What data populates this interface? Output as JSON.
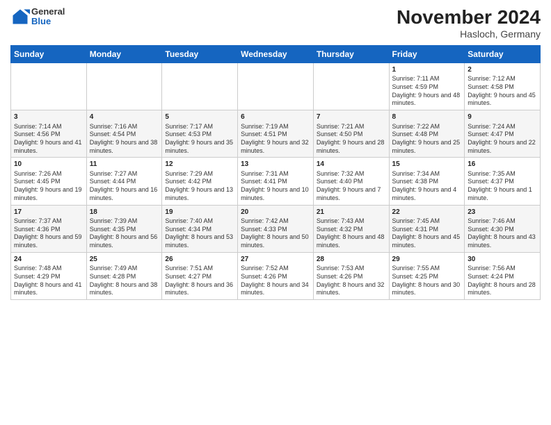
{
  "logo": {
    "general": "General",
    "blue": "Blue"
  },
  "title": "November 2024",
  "location": "Hasloch, Germany",
  "days_of_week": [
    "Sunday",
    "Monday",
    "Tuesday",
    "Wednesday",
    "Thursday",
    "Friday",
    "Saturday"
  ],
  "weeks": [
    [
      {
        "day": "",
        "sunrise": "",
        "sunset": "",
        "daylight": ""
      },
      {
        "day": "",
        "sunrise": "",
        "sunset": "",
        "daylight": ""
      },
      {
        "day": "",
        "sunrise": "",
        "sunset": "",
        "daylight": ""
      },
      {
        "day": "",
        "sunrise": "",
        "sunset": "",
        "daylight": ""
      },
      {
        "day": "",
        "sunrise": "",
        "sunset": "",
        "daylight": ""
      },
      {
        "day": "1",
        "sunrise": "Sunrise: 7:11 AM",
        "sunset": "Sunset: 4:59 PM",
        "daylight": "Daylight: 9 hours and 48 minutes."
      },
      {
        "day": "2",
        "sunrise": "Sunrise: 7:12 AM",
        "sunset": "Sunset: 4:58 PM",
        "daylight": "Daylight: 9 hours and 45 minutes."
      }
    ],
    [
      {
        "day": "3",
        "sunrise": "Sunrise: 7:14 AM",
        "sunset": "Sunset: 4:56 PM",
        "daylight": "Daylight: 9 hours and 41 minutes."
      },
      {
        "day": "4",
        "sunrise": "Sunrise: 7:16 AM",
        "sunset": "Sunset: 4:54 PM",
        "daylight": "Daylight: 9 hours and 38 minutes."
      },
      {
        "day": "5",
        "sunrise": "Sunrise: 7:17 AM",
        "sunset": "Sunset: 4:53 PM",
        "daylight": "Daylight: 9 hours and 35 minutes."
      },
      {
        "day": "6",
        "sunrise": "Sunrise: 7:19 AM",
        "sunset": "Sunset: 4:51 PM",
        "daylight": "Daylight: 9 hours and 32 minutes."
      },
      {
        "day": "7",
        "sunrise": "Sunrise: 7:21 AM",
        "sunset": "Sunset: 4:50 PM",
        "daylight": "Daylight: 9 hours and 28 minutes."
      },
      {
        "day": "8",
        "sunrise": "Sunrise: 7:22 AM",
        "sunset": "Sunset: 4:48 PM",
        "daylight": "Daylight: 9 hours and 25 minutes."
      },
      {
        "day": "9",
        "sunrise": "Sunrise: 7:24 AM",
        "sunset": "Sunset: 4:47 PM",
        "daylight": "Daylight: 9 hours and 22 minutes."
      }
    ],
    [
      {
        "day": "10",
        "sunrise": "Sunrise: 7:26 AM",
        "sunset": "Sunset: 4:45 PM",
        "daylight": "Daylight: 9 hours and 19 minutes."
      },
      {
        "day": "11",
        "sunrise": "Sunrise: 7:27 AM",
        "sunset": "Sunset: 4:44 PM",
        "daylight": "Daylight: 9 hours and 16 minutes."
      },
      {
        "day": "12",
        "sunrise": "Sunrise: 7:29 AM",
        "sunset": "Sunset: 4:42 PM",
        "daylight": "Daylight: 9 hours and 13 minutes."
      },
      {
        "day": "13",
        "sunrise": "Sunrise: 7:31 AM",
        "sunset": "Sunset: 4:41 PM",
        "daylight": "Daylight: 9 hours and 10 minutes."
      },
      {
        "day": "14",
        "sunrise": "Sunrise: 7:32 AM",
        "sunset": "Sunset: 4:40 PM",
        "daylight": "Daylight: 9 hours and 7 minutes."
      },
      {
        "day": "15",
        "sunrise": "Sunrise: 7:34 AM",
        "sunset": "Sunset: 4:38 PM",
        "daylight": "Daylight: 9 hours and 4 minutes."
      },
      {
        "day": "16",
        "sunrise": "Sunrise: 7:35 AM",
        "sunset": "Sunset: 4:37 PM",
        "daylight": "Daylight: 9 hours and 1 minute."
      }
    ],
    [
      {
        "day": "17",
        "sunrise": "Sunrise: 7:37 AM",
        "sunset": "Sunset: 4:36 PM",
        "daylight": "Daylight: 8 hours and 59 minutes."
      },
      {
        "day": "18",
        "sunrise": "Sunrise: 7:39 AM",
        "sunset": "Sunset: 4:35 PM",
        "daylight": "Daylight: 8 hours and 56 minutes."
      },
      {
        "day": "19",
        "sunrise": "Sunrise: 7:40 AM",
        "sunset": "Sunset: 4:34 PM",
        "daylight": "Daylight: 8 hours and 53 minutes."
      },
      {
        "day": "20",
        "sunrise": "Sunrise: 7:42 AM",
        "sunset": "Sunset: 4:33 PM",
        "daylight": "Daylight: 8 hours and 50 minutes."
      },
      {
        "day": "21",
        "sunrise": "Sunrise: 7:43 AM",
        "sunset": "Sunset: 4:32 PM",
        "daylight": "Daylight: 8 hours and 48 minutes."
      },
      {
        "day": "22",
        "sunrise": "Sunrise: 7:45 AM",
        "sunset": "Sunset: 4:31 PM",
        "daylight": "Daylight: 8 hours and 45 minutes."
      },
      {
        "day": "23",
        "sunrise": "Sunrise: 7:46 AM",
        "sunset": "Sunset: 4:30 PM",
        "daylight": "Daylight: 8 hours and 43 minutes."
      }
    ],
    [
      {
        "day": "24",
        "sunrise": "Sunrise: 7:48 AM",
        "sunset": "Sunset: 4:29 PM",
        "daylight": "Daylight: 8 hours and 41 minutes."
      },
      {
        "day": "25",
        "sunrise": "Sunrise: 7:49 AM",
        "sunset": "Sunset: 4:28 PM",
        "daylight": "Daylight: 8 hours and 38 minutes."
      },
      {
        "day": "26",
        "sunrise": "Sunrise: 7:51 AM",
        "sunset": "Sunset: 4:27 PM",
        "daylight": "Daylight: 8 hours and 36 minutes."
      },
      {
        "day": "27",
        "sunrise": "Sunrise: 7:52 AM",
        "sunset": "Sunset: 4:26 PM",
        "daylight": "Daylight: 8 hours and 34 minutes."
      },
      {
        "day": "28",
        "sunrise": "Sunrise: 7:53 AM",
        "sunset": "Sunset: 4:26 PM",
        "daylight": "Daylight: 8 hours and 32 minutes."
      },
      {
        "day": "29",
        "sunrise": "Sunrise: 7:55 AM",
        "sunset": "Sunset: 4:25 PM",
        "daylight": "Daylight: 8 hours and 30 minutes."
      },
      {
        "day": "30",
        "sunrise": "Sunrise: 7:56 AM",
        "sunset": "Sunset: 4:24 PM",
        "daylight": "Daylight: 8 hours and 28 minutes."
      }
    ]
  ]
}
